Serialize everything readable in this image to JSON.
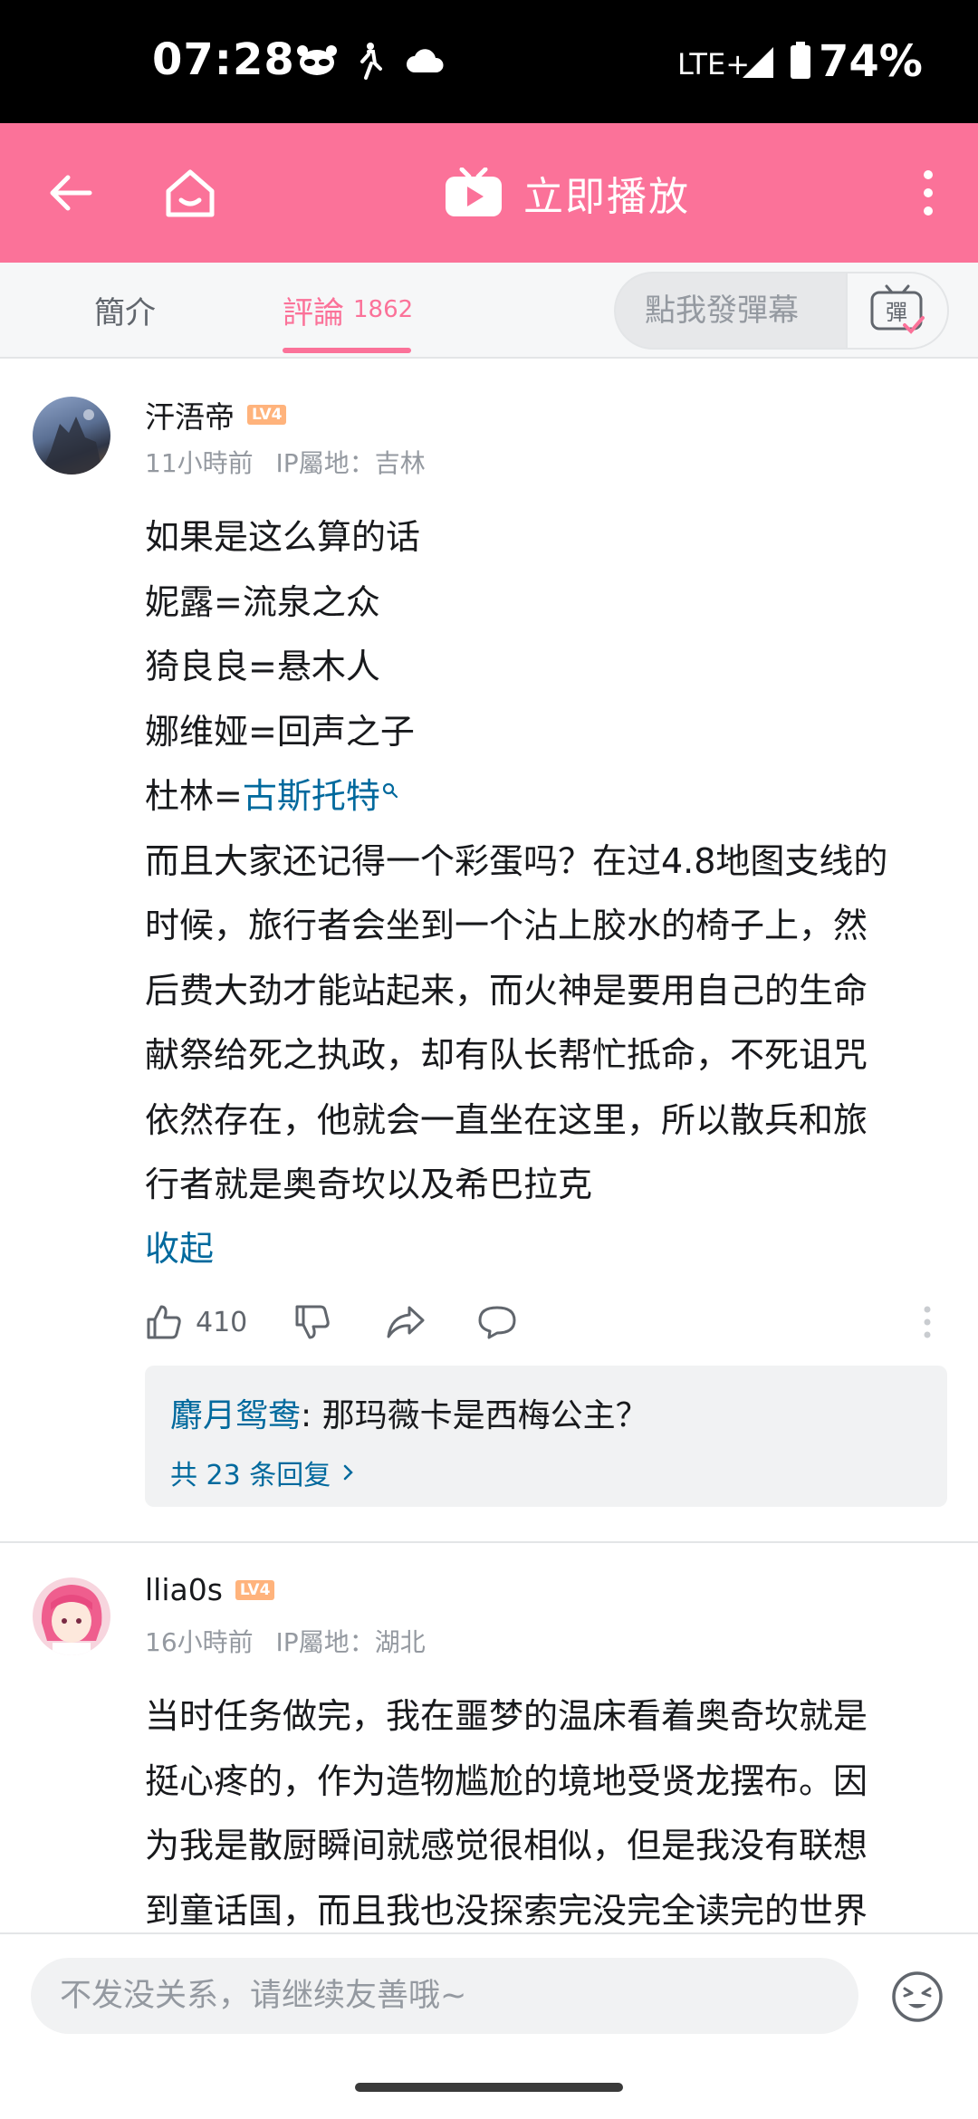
{
  "status_bar": {
    "time": "07:28",
    "network": "LTE+",
    "battery": "74%"
  },
  "app_bar": {
    "title": "立即播放",
    "back_icon": "arrow-left-icon",
    "home_icon": "home-icon",
    "more_icon": "more-vertical-icon",
    "color": "#fb7299"
  },
  "tabs": {
    "intro_label": "簡介",
    "comments_label": "評論",
    "comments_count": "1862",
    "danmaku_placeholder": "點我發彈幕",
    "danmaku_icon": "彈"
  },
  "comments": [
    {
      "username": "汗浯帝",
      "level": "LV4",
      "time": "11小時前",
      "ip": "IP屬地：吉林",
      "lines": [
        "如果是这么算的话",
        "妮露=流泉之众",
        "猗良良=悬木人",
        "娜维娅=回声之子",
        "而且大家还记得一个彩蛋吗？在过4.8地图支线的",
        "时候，旅行者会坐到一个沾上胶水的椅子上，然",
        "后费大劲才能站起来，而火神是要用自己的生命",
        "献祭给死之执政，却有队长帮忙抵命，不死诅咒",
        "依然存在，他就会一直坐在这里，所以散兵和旅",
        "行者就是奥奇坎以及希巴拉克"
      ],
      "link_prefix": "杜林=",
      "link_text": "古斯托特",
      "collapse_label": "收起",
      "likes": "410",
      "reply_preview": {
        "author": "麝月鸳鸯",
        "text": ": 那玛薇卡是西梅公主？",
        "total": "共 23 条回复"
      }
    },
    {
      "username": "llia0s",
      "level": "LV4",
      "time": "16小時前",
      "ip": "IP屬地：湖北",
      "lines": [
        "当时任务做完，我在噩梦的温床看着奥奇坎就是",
        "挺心疼的，作为造物尴尬的境地受贤龙摆布。因",
        "为我是散厨瞬间就感觉很相似，但是我没有联想",
        "到童话国，而且我也没探索完没完全读完的世界"
      ]
    }
  ],
  "input_bar": {
    "placeholder": "不发没关系，请继续友善哦~",
    "emoji_icon": "emoji-face-icon"
  }
}
